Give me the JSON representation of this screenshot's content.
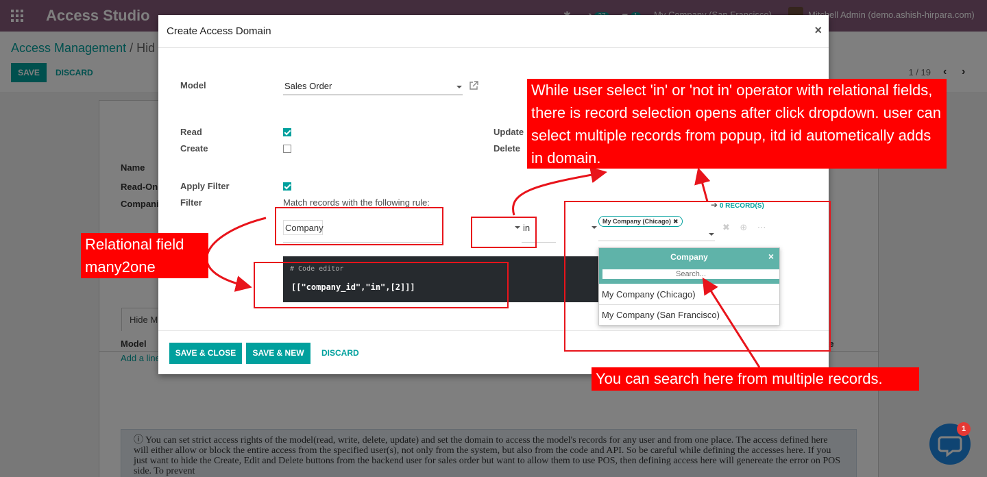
{
  "navbar": {
    "brand": "Access Studio",
    "activity_count": "37",
    "message_count": "1",
    "company": "My Company (San Francisco)",
    "user": "Mitchell Admin (demo.ashish-hirpara.com)"
  },
  "page": {
    "breadcrumb_root": "Access Management",
    "breadcrumb_sep": "/",
    "breadcrumb_current": "Hid",
    "save_label": "SAVE",
    "discard_label": "DISCARD",
    "pager": "1 / 19"
  },
  "sheet": {
    "name_label": "Name",
    "readonly_label": "Read-Only",
    "companies_label": "Companie",
    "tab_label": "Hide M",
    "model_col": "Model",
    "col_right": "te",
    "add_line": "Add a line",
    "note": "You can set strict access rights of the model(read, write, delete, update) and set the domain to access the model's records for any user and from one place. The access defined here will either allow or block the entire access from the specified user(s), not only from the system, but also from the code and API. So be careful while defining the accesses here. If you just want to hide the Create, Edit and Delete buttons from the backend user for sales order but want to allow them to use POS, then defining access here will genereate the error on POS side. To prevent"
  },
  "modal": {
    "title": "Create Access Domain",
    "close": "×",
    "model_label": "Model",
    "model_value": "Sales Order",
    "read_label": "Read",
    "create_label": "Create",
    "update_label": "Update",
    "delete_label": "Delete",
    "apply_filter_label": "Apply Filter",
    "filter_label": "Filter",
    "rule_text": "Match records with the following rule:",
    "field_value": "Company",
    "operator_value": "in",
    "tag_value": "My Company (Chicago)",
    "records_link": "0 RECORD(S)",
    "code_comment": "# Code editor",
    "code_value": "[[\"company_id\",\"in\",[2]]]",
    "save_close": "SAVE & CLOSE",
    "save_new": "SAVE & NEW",
    "discard": "DISCARD",
    "read_checked": true,
    "create_checked": false,
    "apply_filter_checked": true
  },
  "popup": {
    "title": "Company",
    "close": "×",
    "search_placeholder": "Search...",
    "items": [
      "My Company (Chicago)",
      "My Company (San Francisco)"
    ]
  },
  "annotations": {
    "top_callout": "While user select 'in' or 'not in' operator with relational fields, there is record selection opens after click dropdown. user can select multiple records from popup, itd id autometically adds in domain.",
    "left_callout": "Relational field many2one",
    "bottom_callout": "You can search here from multiple records."
  },
  "chat": {
    "badge": "1"
  },
  "colors": {
    "brand": "#875a7b",
    "accent": "#00a09d",
    "annotation": "#ff0000"
  }
}
